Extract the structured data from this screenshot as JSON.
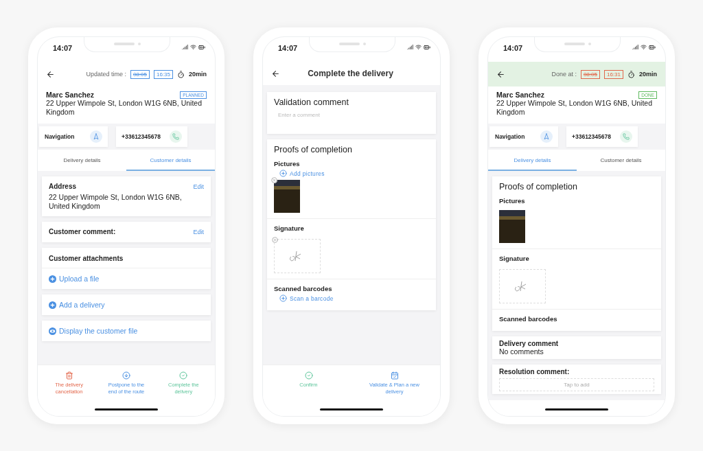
{
  "phones": [
    {
      "time": "14:07",
      "top_bar": {
        "kind": "times",
        "completed": false,
        "label": "Updated time :",
        "times": [
          {
            "text": "08:05",
            "struck": true
          },
          {
            "text": "16:35",
            "struck": false
          }
        ],
        "duration": "20min"
      },
      "customer": {
        "name": "Marc Sanchez",
        "address": "22 Upper Wimpole St, London W1G 6NB, United Kingdom",
        "badge": "PLANNED"
      },
      "contacts": [
        {
          "kind": "navigation",
          "label": "Navigation"
        },
        {
          "kind": "phone",
          "label": "+33612345678"
        }
      ],
      "tabs": [
        {
          "label": "Delivery details",
          "selected": false
        },
        {
          "label": "Customer details",
          "selected": true
        }
      ],
      "cards": [
        {
          "kind": "field",
          "title": "Address",
          "edit": "Edit",
          "value": "22 Upper Wimpole St, London W1G 6NB, United Kingdom"
        },
        {
          "kind": "field",
          "title": "Customer comment:",
          "edit": "Edit"
        },
        {
          "kind": "links",
          "title": "Customer attachments",
          "links": [
            {
              "kind": "add",
              "label": "Upload a file"
            }
          ]
        },
        {
          "kind": "links",
          "links": [
            {
              "kind": "add",
              "label": "Add a delivery"
            }
          ]
        },
        {
          "kind": "links",
          "links": [
            {
              "kind": "view",
              "label": "Display the customer file"
            }
          ]
        }
      ],
      "actions": [
        {
          "kind": "cancel",
          "label": "The delivery cancellation"
        },
        {
          "kind": "postpone",
          "label": "Postpone to the end of the route"
        },
        {
          "kind": "complete",
          "label": "Complete the delivery"
        }
      ]
    },
    {
      "time": "14:07",
      "top_bar": {
        "kind": "title",
        "title": "Complete the delivery"
      },
      "cards": [
        {
          "kind": "comment-input",
          "title": "Validation comment",
          "placeholder": "Enter a comment"
        },
        {
          "kind": "proofs",
          "title": "Proofs of completion",
          "sections": [
            {
              "kind": "pictures",
              "title": "Pictures",
              "add": "Add pictures",
              "removable": true
            },
            {
              "kind": "signature",
              "title": "Signature",
              "removable": true
            },
            {
              "kind": "barcodes",
              "title": "Scanned barcodes",
              "add": "Scan a barcode"
            }
          ]
        }
      ],
      "actions": [
        {
          "kind": "confirm",
          "label": "Confirm"
        },
        {
          "kind": "plan",
          "label": "Validate & Plan a new delivery"
        }
      ]
    },
    {
      "time": "14:07",
      "top_bar": {
        "kind": "times",
        "completed": true,
        "label": "Done at :",
        "times": [
          {
            "text": "08:05",
            "struck": true
          },
          {
            "text": "16:31",
            "struck": false
          }
        ],
        "duration": "20min"
      },
      "customer": {
        "name": "Marc Sanchez",
        "address": "22 Upper Wimpole St, London W1G 6NB, United Kingdom",
        "badge": "DONE"
      },
      "contacts": [
        {
          "kind": "navigation",
          "label": "Navigation"
        },
        {
          "kind": "phone",
          "label": "+33612345678"
        }
      ],
      "tabs": [
        {
          "label": "Delivery details",
          "selected": true
        },
        {
          "label": "Customer details",
          "selected": false
        }
      ],
      "cards": [
        {
          "kind": "proofs",
          "title": "Proofs of completion",
          "sections": [
            {
              "kind": "pictures",
              "title": "Pictures",
              "removable": false
            },
            {
              "kind": "signature",
              "title": "Signature",
              "removable": false
            },
            {
              "kind": "barcodes",
              "title": "Scanned barcodes"
            }
          ]
        },
        {
          "kind": "text",
          "title": "Delivery comment",
          "value": "No comments"
        },
        {
          "kind": "tap-input",
          "title": "Resolution comment:",
          "placeholder": "Tap to add"
        }
      ]
    }
  ]
}
